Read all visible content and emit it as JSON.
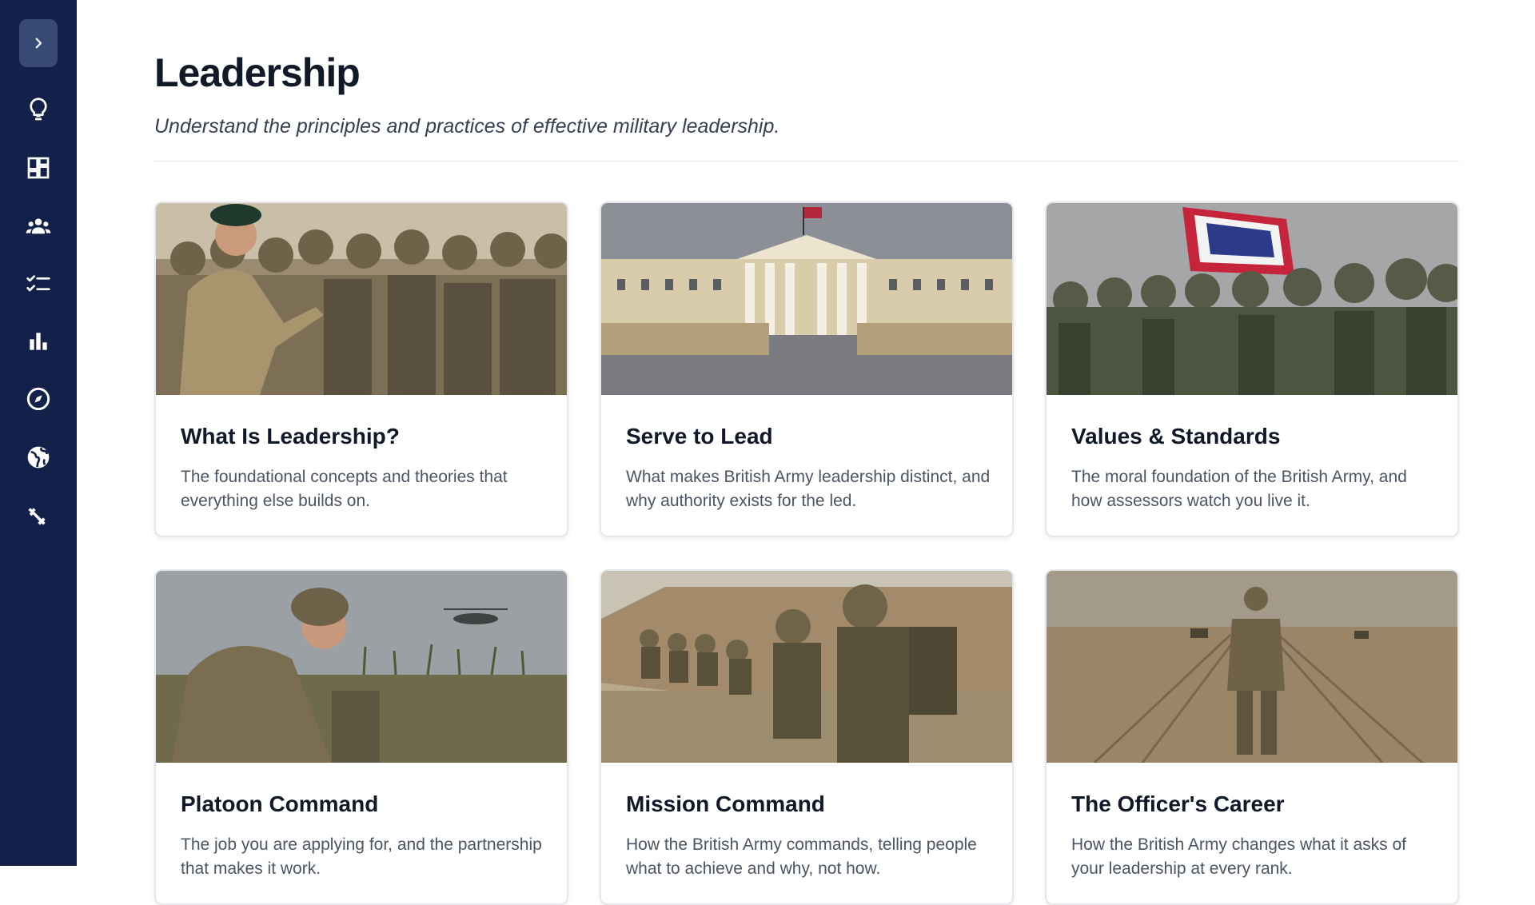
{
  "sidebar": {
    "items": [
      {
        "icon": "lightbulb-icon"
      },
      {
        "icon": "dashboard-icon"
      },
      {
        "icon": "group-icon"
      },
      {
        "icon": "checklist-icon"
      },
      {
        "icon": "bar-chart-icon"
      },
      {
        "icon": "compass-icon"
      },
      {
        "icon": "globe-icon"
      },
      {
        "icon": "fitness-icon"
      }
    ]
  },
  "header": {
    "title": "Leadership",
    "subtitle": "Understand the principles and practices of effective military leadership."
  },
  "cards": [
    {
      "title": "What Is Leadership?",
      "description": "The foundational concepts and theories that everything else builds on."
    },
    {
      "title": "Serve to Lead",
      "description": "What makes British Army leadership distinct, and why authority exists for the led."
    },
    {
      "title": "Values & Standards",
      "description": "The moral foundation of the British Army, and how assessors watch you live it."
    },
    {
      "title": "Platoon Command",
      "description": "The job you are applying for, and the partnership that makes it work."
    },
    {
      "title": "Mission Command",
      "description": "How the British Army commands, telling people what to achieve and why, not how."
    },
    {
      "title": "The Officer's Career",
      "description": "How the British Army changes what it asks of your leadership at every rank."
    }
  ]
}
